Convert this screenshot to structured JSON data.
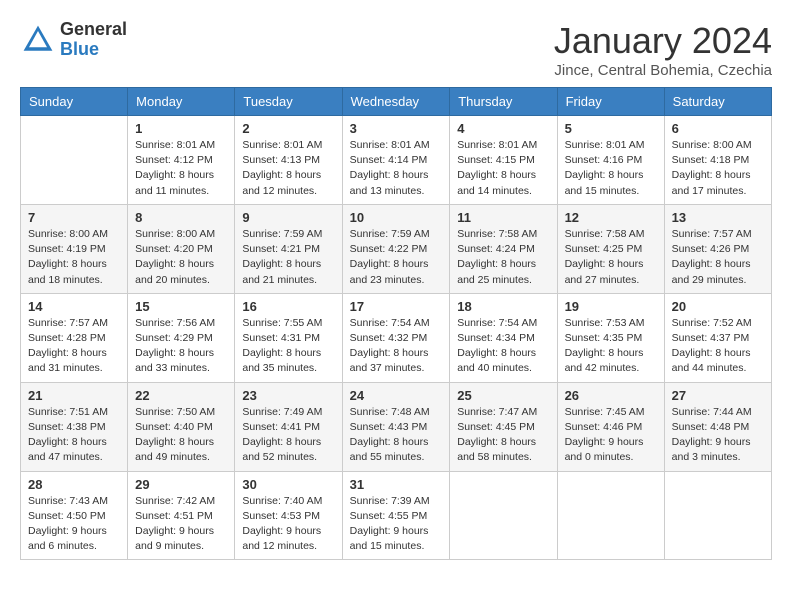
{
  "logo": {
    "general": "General",
    "blue": "Blue"
  },
  "title": "January 2024",
  "subtitle": "Jince, Central Bohemia, Czechia",
  "days_of_week": [
    "Sunday",
    "Monday",
    "Tuesday",
    "Wednesday",
    "Thursday",
    "Friday",
    "Saturday"
  ],
  "weeks": [
    [
      {
        "day": "",
        "sunrise": "",
        "sunset": "",
        "daylight": ""
      },
      {
        "day": "1",
        "sunrise": "Sunrise: 8:01 AM",
        "sunset": "Sunset: 4:12 PM",
        "daylight": "Daylight: 8 hours and 11 minutes."
      },
      {
        "day": "2",
        "sunrise": "Sunrise: 8:01 AM",
        "sunset": "Sunset: 4:13 PM",
        "daylight": "Daylight: 8 hours and 12 minutes."
      },
      {
        "day": "3",
        "sunrise": "Sunrise: 8:01 AM",
        "sunset": "Sunset: 4:14 PM",
        "daylight": "Daylight: 8 hours and 13 minutes."
      },
      {
        "day": "4",
        "sunrise": "Sunrise: 8:01 AM",
        "sunset": "Sunset: 4:15 PM",
        "daylight": "Daylight: 8 hours and 14 minutes."
      },
      {
        "day": "5",
        "sunrise": "Sunrise: 8:01 AM",
        "sunset": "Sunset: 4:16 PM",
        "daylight": "Daylight: 8 hours and 15 minutes."
      },
      {
        "day": "6",
        "sunrise": "Sunrise: 8:00 AM",
        "sunset": "Sunset: 4:18 PM",
        "daylight": "Daylight: 8 hours and 17 minutes."
      }
    ],
    [
      {
        "day": "7",
        "sunrise": "Sunrise: 8:00 AM",
        "sunset": "Sunset: 4:19 PM",
        "daylight": "Daylight: 8 hours and 18 minutes."
      },
      {
        "day": "8",
        "sunrise": "Sunrise: 8:00 AM",
        "sunset": "Sunset: 4:20 PM",
        "daylight": "Daylight: 8 hours and 20 minutes."
      },
      {
        "day": "9",
        "sunrise": "Sunrise: 7:59 AM",
        "sunset": "Sunset: 4:21 PM",
        "daylight": "Daylight: 8 hours and 21 minutes."
      },
      {
        "day": "10",
        "sunrise": "Sunrise: 7:59 AM",
        "sunset": "Sunset: 4:22 PM",
        "daylight": "Daylight: 8 hours and 23 minutes."
      },
      {
        "day": "11",
        "sunrise": "Sunrise: 7:58 AM",
        "sunset": "Sunset: 4:24 PM",
        "daylight": "Daylight: 8 hours and 25 minutes."
      },
      {
        "day": "12",
        "sunrise": "Sunrise: 7:58 AM",
        "sunset": "Sunset: 4:25 PM",
        "daylight": "Daylight: 8 hours and 27 minutes."
      },
      {
        "day": "13",
        "sunrise": "Sunrise: 7:57 AM",
        "sunset": "Sunset: 4:26 PM",
        "daylight": "Daylight: 8 hours and 29 minutes."
      }
    ],
    [
      {
        "day": "14",
        "sunrise": "Sunrise: 7:57 AM",
        "sunset": "Sunset: 4:28 PM",
        "daylight": "Daylight: 8 hours and 31 minutes."
      },
      {
        "day": "15",
        "sunrise": "Sunrise: 7:56 AM",
        "sunset": "Sunset: 4:29 PM",
        "daylight": "Daylight: 8 hours and 33 minutes."
      },
      {
        "day": "16",
        "sunrise": "Sunrise: 7:55 AM",
        "sunset": "Sunset: 4:31 PM",
        "daylight": "Daylight: 8 hours and 35 minutes."
      },
      {
        "day": "17",
        "sunrise": "Sunrise: 7:54 AM",
        "sunset": "Sunset: 4:32 PM",
        "daylight": "Daylight: 8 hours and 37 minutes."
      },
      {
        "day": "18",
        "sunrise": "Sunrise: 7:54 AM",
        "sunset": "Sunset: 4:34 PM",
        "daylight": "Daylight: 8 hours and 40 minutes."
      },
      {
        "day": "19",
        "sunrise": "Sunrise: 7:53 AM",
        "sunset": "Sunset: 4:35 PM",
        "daylight": "Daylight: 8 hours and 42 minutes."
      },
      {
        "day": "20",
        "sunrise": "Sunrise: 7:52 AM",
        "sunset": "Sunset: 4:37 PM",
        "daylight": "Daylight: 8 hours and 44 minutes."
      }
    ],
    [
      {
        "day": "21",
        "sunrise": "Sunrise: 7:51 AM",
        "sunset": "Sunset: 4:38 PM",
        "daylight": "Daylight: 8 hours and 47 minutes."
      },
      {
        "day": "22",
        "sunrise": "Sunrise: 7:50 AM",
        "sunset": "Sunset: 4:40 PM",
        "daylight": "Daylight: 8 hours and 49 minutes."
      },
      {
        "day": "23",
        "sunrise": "Sunrise: 7:49 AM",
        "sunset": "Sunset: 4:41 PM",
        "daylight": "Daylight: 8 hours and 52 minutes."
      },
      {
        "day": "24",
        "sunrise": "Sunrise: 7:48 AM",
        "sunset": "Sunset: 4:43 PM",
        "daylight": "Daylight: 8 hours and 55 minutes."
      },
      {
        "day": "25",
        "sunrise": "Sunrise: 7:47 AM",
        "sunset": "Sunset: 4:45 PM",
        "daylight": "Daylight: 8 hours and 58 minutes."
      },
      {
        "day": "26",
        "sunrise": "Sunrise: 7:45 AM",
        "sunset": "Sunset: 4:46 PM",
        "daylight": "Daylight: 9 hours and 0 minutes."
      },
      {
        "day": "27",
        "sunrise": "Sunrise: 7:44 AM",
        "sunset": "Sunset: 4:48 PM",
        "daylight": "Daylight: 9 hours and 3 minutes."
      }
    ],
    [
      {
        "day": "28",
        "sunrise": "Sunrise: 7:43 AM",
        "sunset": "Sunset: 4:50 PM",
        "daylight": "Daylight: 9 hours and 6 minutes."
      },
      {
        "day": "29",
        "sunrise": "Sunrise: 7:42 AM",
        "sunset": "Sunset: 4:51 PM",
        "daylight": "Daylight: 9 hours and 9 minutes."
      },
      {
        "day": "30",
        "sunrise": "Sunrise: 7:40 AM",
        "sunset": "Sunset: 4:53 PM",
        "daylight": "Daylight: 9 hours and 12 minutes."
      },
      {
        "day": "31",
        "sunrise": "Sunrise: 7:39 AM",
        "sunset": "Sunset: 4:55 PM",
        "daylight": "Daylight: 9 hours and 15 minutes."
      },
      {
        "day": "",
        "sunrise": "",
        "sunset": "",
        "daylight": ""
      },
      {
        "day": "",
        "sunrise": "",
        "sunset": "",
        "daylight": ""
      },
      {
        "day": "",
        "sunrise": "",
        "sunset": "",
        "daylight": ""
      }
    ]
  ]
}
